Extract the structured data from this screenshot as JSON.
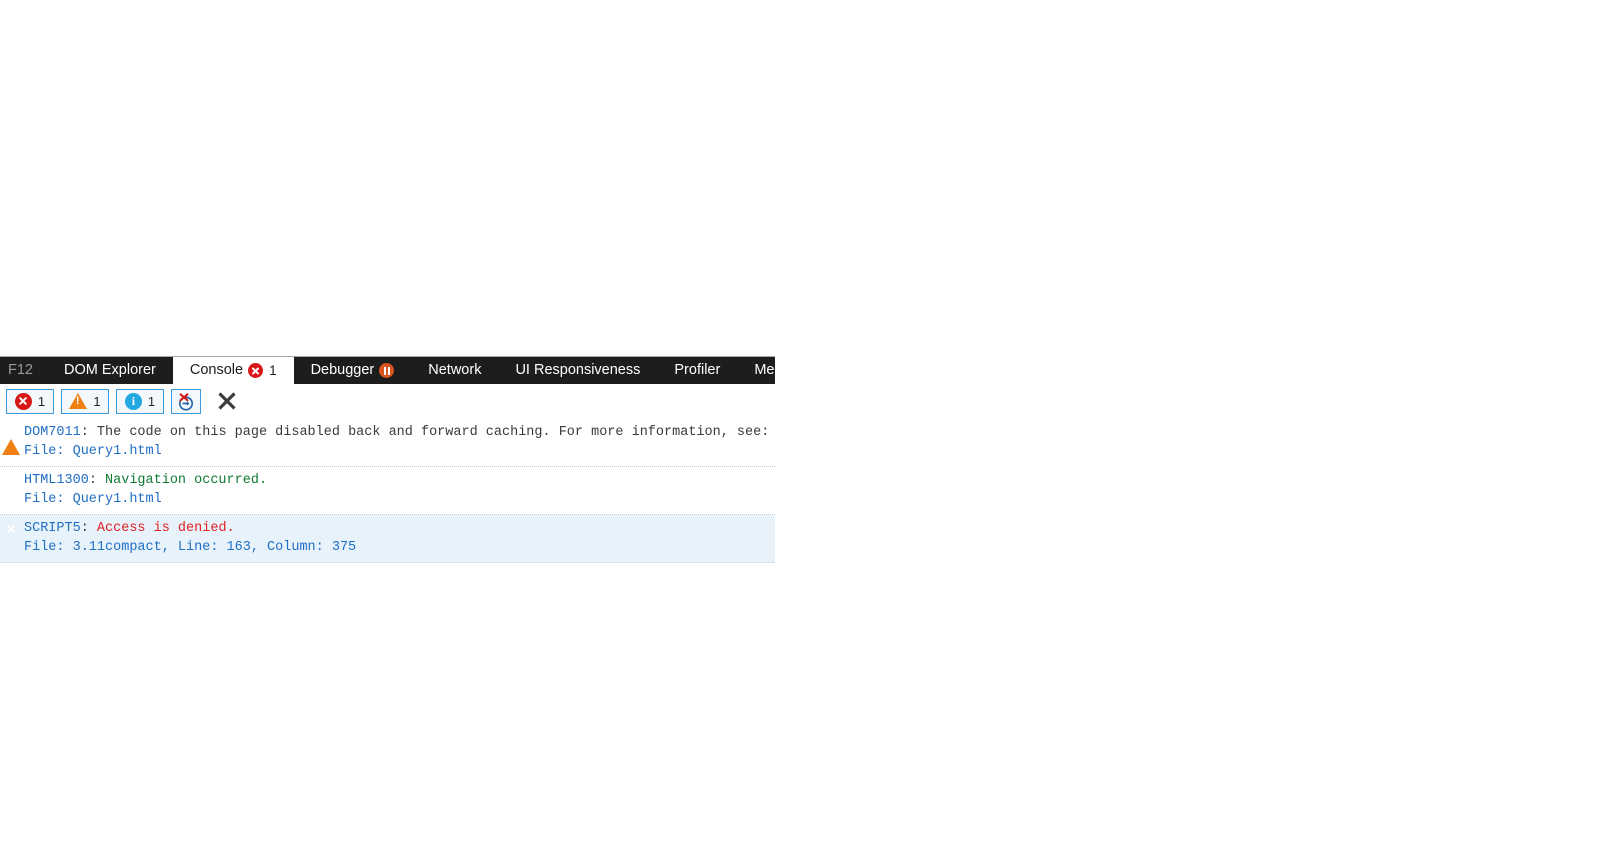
{
  "tabstrip": {
    "f12_label": "F12",
    "tabs": [
      {
        "label": "DOM Explorer",
        "active": false,
        "badge": null,
        "badge_count": null
      },
      {
        "label": "Console",
        "active": true,
        "badge": "error-badge-icon",
        "badge_count": "1"
      },
      {
        "label": "Debugger",
        "active": false,
        "badge": "pause-badge-icon",
        "badge_count": null
      },
      {
        "label": "Network",
        "active": false,
        "badge": null,
        "badge_count": null
      },
      {
        "label": "UI Responsiveness",
        "active": false,
        "badge": null,
        "badge_count": null
      },
      {
        "label": "Profiler",
        "active": false,
        "badge": null,
        "badge_count": null
      },
      {
        "label": "Memory",
        "active": false,
        "badge": null,
        "badge_count": null
      }
    ]
  },
  "toolbar": {
    "errors": {
      "icon": "error-circle-icon",
      "count": "1"
    },
    "warnings": {
      "icon": "warning-triangle-icon",
      "count": "1"
    },
    "info": {
      "icon": "info-circle-icon",
      "count": "1"
    },
    "clear_on_navigate": {
      "icon": "clear-on-navigate-icon"
    },
    "clear_console": {
      "icon": "clear-console-x-icon"
    }
  },
  "console": {
    "messages": [
      {
        "severity": "warning",
        "icon": "warning-triangle-icon",
        "code": "DOM7011",
        "separator": ": ",
        "text": "The code on this page disabled back and forward caching. For more information, see:",
        "text_color": "default",
        "file_line": "File: Query1.html",
        "selected": false
      },
      {
        "severity": "info",
        "icon": "info-circle-icon",
        "code": "HTML1300",
        "separator": ": ",
        "text": "Navigation occurred.",
        "text_color": "green",
        "file_line": "File: Query1.html",
        "selected": false
      },
      {
        "severity": "error",
        "icon": "error-circle-icon",
        "code": "SCRIPT5",
        "separator": ": ",
        "text": "Access is denied.",
        "text_color": "red",
        "file_line": "File: 3.11compact, Line: 163, Column: 375",
        "selected": true
      }
    ]
  },
  "colors": {
    "tabstrip_bg": "#1d1d1d",
    "active_tab_bg": "#ffffff",
    "error_red": "#d81717",
    "warning_orange": "#f08014",
    "info_blue": "#22a7e0",
    "link_blue": "#1f6fc4",
    "selection_bg": "#e8f2fb",
    "button_border": "#3c9ade"
  }
}
